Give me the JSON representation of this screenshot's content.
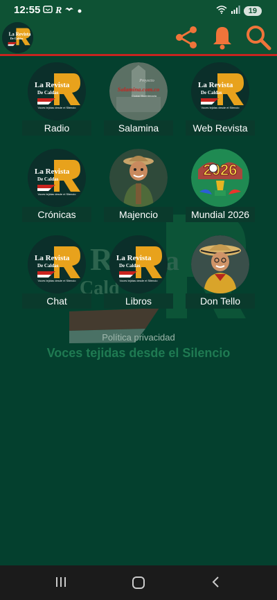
{
  "status_bar": {
    "time": "12:55",
    "battery": "19",
    "left_icons": [
      "messenger-icon",
      "r-icon",
      "bird-icon",
      "dot-icon"
    ]
  },
  "app_bar": {
    "logo_text": "La Revista De Caldas",
    "logo_tagline": "Voces tejidas desde el Silencio",
    "actions": [
      "share-icon",
      "bell-icon",
      "search-icon"
    ],
    "accent": "#c8241f",
    "background": "#0e5234"
  },
  "grid": {
    "items": [
      {
        "label": "Radio",
        "icon": "revista-logo"
      },
      {
        "label": "Salamina",
        "icon": "salamina-logo"
      },
      {
        "label": "Web Revista",
        "icon": "revista-logo"
      },
      {
        "label": "Crónicas",
        "icon": "revista-logo"
      },
      {
        "label": "Majencio",
        "icon": "majencio-character"
      },
      {
        "label": "Mundial 2026",
        "icon": "mundial-2026-logo"
      },
      {
        "label": "Chat",
        "icon": "revista-logo"
      },
      {
        "label": "Libros",
        "icon": "revista-logo"
      },
      {
        "label": "Don Tello",
        "icon": "don-tello-character"
      }
    ]
  },
  "logo": {
    "line1": "La Revista",
    "line2": "De Caldas",
    "tagline": "Voces tejidas desde el Silencio"
  },
  "salamina": {
    "line1": "Proyecto",
    "line2": "Salamina.com.co",
    "line3": "Ciudad Bicentenaria"
  },
  "privacy": "Política privacidad",
  "watermark_tagline": "Voces tejidas desde el Silencio",
  "colors": {
    "background": "#04402e",
    "label_bg": "#0a3a2c"
  }
}
